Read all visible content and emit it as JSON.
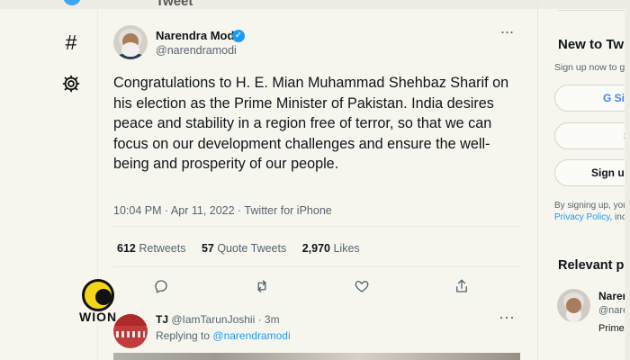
{
  "left_nav": {
    "hashtag_icon": "#",
    "settings_icon": "gear-icon"
  },
  "tweet": {
    "author_name": "Narendra Modi",
    "author_handle": "@narendramodi",
    "verified_icon": "✓",
    "more_icon": "···",
    "body": "Congratulations to H. E. Mian Muhammad Shehbaz Sharif on his election as the Prime Minister of Pakistan. India desires peace and stability in a region free of terror, so that we can focus on our development challenges and ensure the well-being and prosperity of our people.",
    "timestamp": "10:04 PM · Apr 11, 2022 · Twitter for iPhone",
    "stats": [
      {
        "value": "612",
        "label": "Retweets"
      },
      {
        "value": "57",
        "label": "Quote Tweets"
      },
      {
        "value": "2,970",
        "label": "Likes"
      }
    ],
    "actions": [
      "reply-icon",
      "retweet-icon",
      "like-icon",
      "share-icon"
    ]
  },
  "reply": {
    "name": "TJ",
    "handle": "@IamTarunJoshii",
    "time": "· 3m",
    "replying_prefix": "Replying to",
    "replying_to": "@narendramodi",
    "more_icon": "···"
  },
  "watermark": {
    "brand": "WION"
  },
  "right_rail": {
    "signup_title": "New to Twi",
    "signup_subtitle": "Sign up now to get",
    "google_button": "G Si",
    "apple_button": "S",
    "signup_button": "Sign up",
    "terms_prefix": "By signing up, you",
    "privacy_link": "Privacy Policy",
    "terms_suffix": ", incl",
    "relevant_title": "Relevant p",
    "relevant_name": "Naren",
    "relevant_handle": "@nare",
    "relevant_bio": "Prime"
  },
  "colors": {
    "background": "#f7f6ee",
    "twitter_blue": "#1d9bf0",
    "muted_text": "#536471",
    "wion_yellow": "#f3d51a"
  }
}
